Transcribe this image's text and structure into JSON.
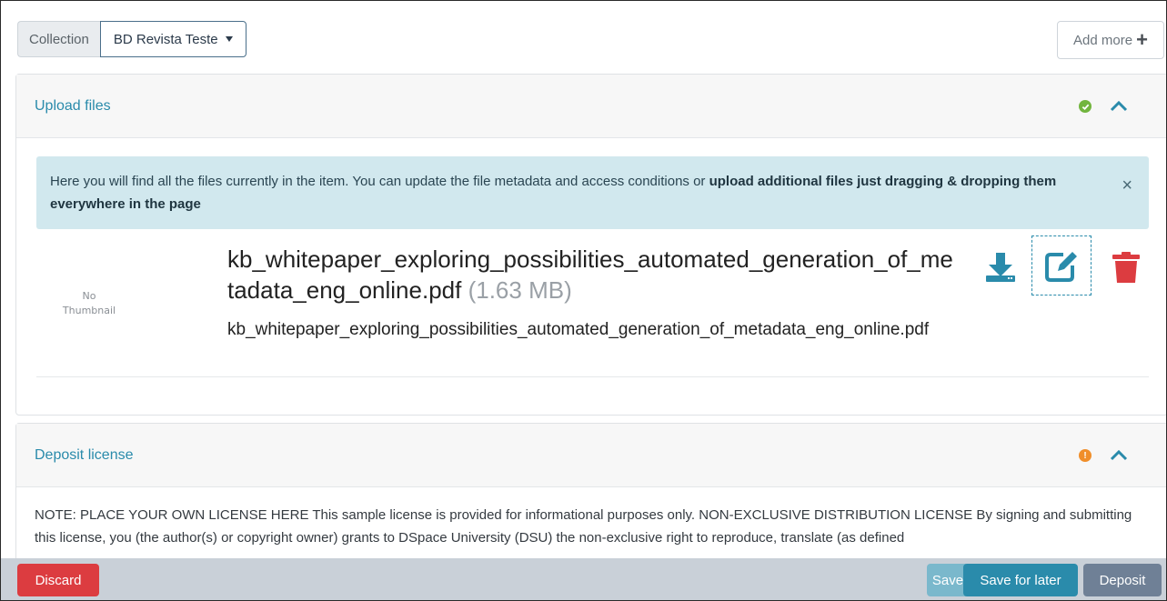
{
  "header": {
    "collection_label": "Collection",
    "collection_value": "BD Revista Teste",
    "add_more_label": "Add more"
  },
  "upload_panel": {
    "title": "Upload files",
    "status": "ok",
    "alert_text_plain": "Here you will find all the files currently in the item. You can update the file metadata and access conditions or ",
    "alert_text_bold": "upload additional files just dragging & dropping them everywhere in the page",
    "file": {
      "thumbnail_line1": "No",
      "thumbnail_line2": "Thumbnail",
      "name": "kb_whitepaper_exploring_possibilities_automated_generation_of_metadata_eng_online.pdf",
      "size": "(1.63 MB)",
      "subtitle": "kb_whitepaper_exploring_possibilities_automated_generation_of_metadata_eng_online.pdf"
    }
  },
  "deposit_panel": {
    "title": "Deposit license",
    "status": "warning",
    "license_text": "NOTE: PLACE YOUR OWN LICENSE HERE This sample license is provided for informational purposes only. NON-EXCLUSIVE DISTRIBUTION LICENSE By signing and submitting this license, you (the author(s) or copyright owner) grants to DSpace University (DSU) the non-exclusive right to reproduce, translate (as defined"
  },
  "footer": {
    "discard_label": "Discard",
    "save_label": "Save",
    "save_later_label": "Save for later",
    "deposit_label": "Deposit"
  },
  "colors": {
    "accent": "#2a8bab",
    "danger": "#dc3c40",
    "success": "#72b53e",
    "warning": "#f08e2a",
    "alert_bg": "#d1e8ee"
  },
  "icons": [
    "caret-down-icon",
    "plus-icon",
    "check-circle-icon",
    "chevron-up-icon",
    "close-icon",
    "download-icon",
    "edit-icon",
    "trash-icon",
    "exclamation-circle-icon"
  ]
}
